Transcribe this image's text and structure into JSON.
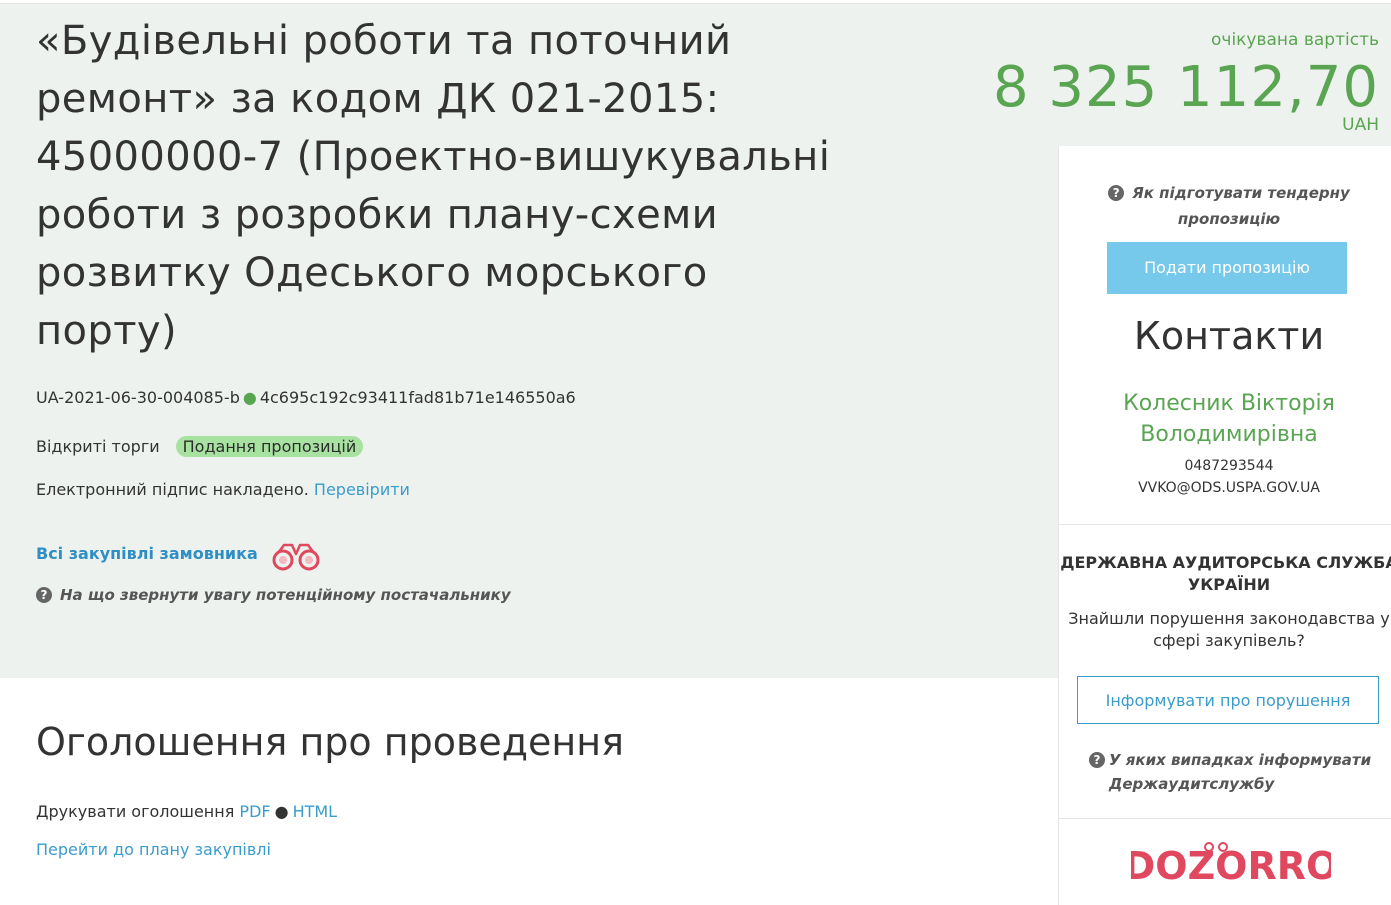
{
  "tender": {
    "title": "«Будівельні роботи та поточний ремонт» за кодом ДК 021-2015: 45000000-7 (Проектно-вишукувальні роботи з розробки плану-схеми розвитку Одеського морського порту)",
    "tender_id": "UA-2021-06-30-004085-b",
    "hash": "4c695c192c93411fad81b71e146550a6",
    "procedure_type": "Відкриті торги",
    "status_badge": "Подання пропозицій",
    "signature_text": "Електронний підпис накладено.",
    "verify_link": "Перевірити",
    "all_purchases_link": "Всі закупівлі замовника",
    "supplier_hint": "На що звернути увагу потенційному постачальнику"
  },
  "price": {
    "label": "очікувана вартість",
    "value": "8 325 112,70",
    "currency": "UAH"
  },
  "sidebar": {
    "prepare_hint": "Як підготувати тендерну пропозицію",
    "submit_button": "Подати пропозицію",
    "contacts_heading": "Контакти",
    "contact_name": "Колесник Вікторія Володимирівна",
    "contact_phone": "0487293544",
    "contact_email": "VVKO@ODS.USPA.GOV.UA",
    "audit_title": "ДЕРЖАВНА АУДИТОРСЬКА СЛУЖБА УКРАЇНИ",
    "audit_question": "Знайшли порушення законодавства у сфері закупівель?",
    "inform_button": "Інформувати про порушення",
    "audit_hint": "У яких випадках інформувати Держаудитслужбу",
    "logo_text": "DOZORRO"
  },
  "announcement": {
    "heading": "Оголошення про проведення",
    "print_label": "Друкувати оголошення",
    "pdf_link": "PDF",
    "html_link": "HTML",
    "plan_link": "Перейти до плану закупівлі"
  },
  "colors": {
    "green": "#5aa552",
    "link": "#3a9ccc",
    "button": "#76c9ea",
    "badge": "#a8e2a0",
    "hero_bg": "#eef2ef",
    "dozorro": "#e0485f"
  },
  "icons": {
    "question": "question-circle-icon",
    "binoculars": "binoculars-icon"
  }
}
